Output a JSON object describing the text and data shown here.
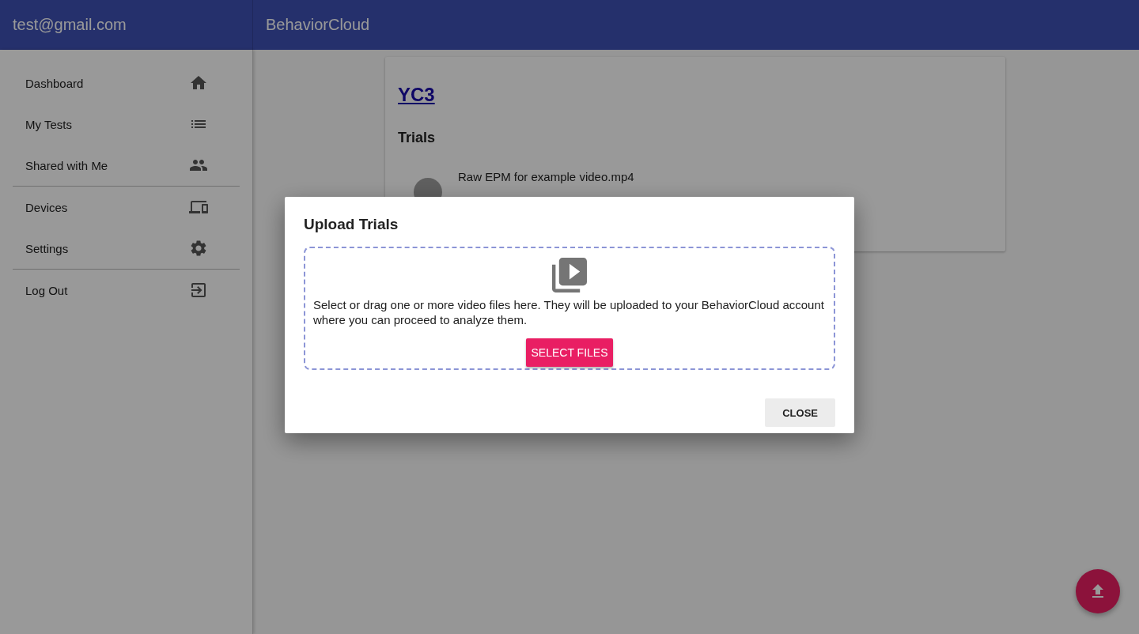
{
  "header": {
    "account": "test@gmail.com",
    "title": "BehaviorCloud"
  },
  "sidebar": {
    "groups": [
      {
        "items": [
          {
            "label": "Dashboard",
            "kind": "home"
          },
          {
            "label": "My Tests",
            "kind": "list"
          },
          {
            "label": "Shared with Me",
            "kind": "people"
          }
        ]
      },
      {
        "items": [
          {
            "label": "Devices",
            "kind": "devices"
          },
          {
            "label": "Settings",
            "kind": "settings"
          }
        ]
      },
      {
        "items": [
          {
            "label": "Log Out",
            "kind": "logout"
          }
        ]
      }
    ]
  },
  "test": {
    "title": "YC3",
    "section": "Trials",
    "trials": [
      {
        "name": "Raw EPM for example video.mp4"
      }
    ]
  },
  "dialog": {
    "title": "Upload Trials",
    "message": "Select or drag one or more video files here. They will be uploaded to your BehaviorCloud account where you can proceed to analyze them.",
    "select_button": "SELECT FILES",
    "close_button": "CLOSE"
  }
}
